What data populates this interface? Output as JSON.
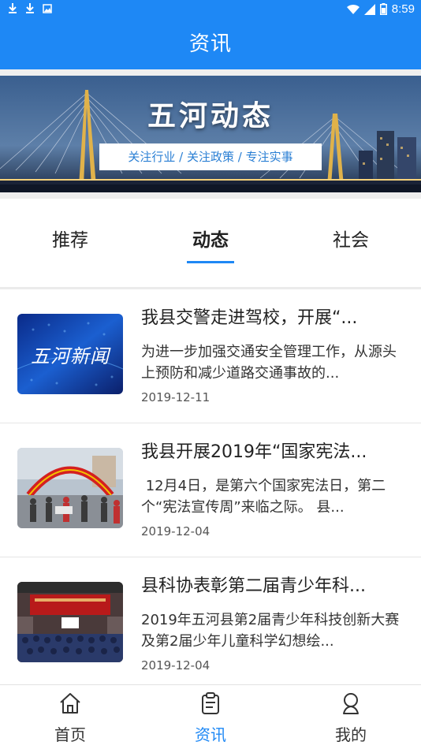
{
  "status_bar": {
    "time": "8:59",
    "left_icons": [
      "download-icon",
      "download-icon",
      "image-icon"
    ],
    "right_icons": [
      "wifi-icon",
      "signal-icon",
      "battery-icon"
    ]
  },
  "app_bar": {
    "title": "资讯"
  },
  "banner": {
    "title": "五河动态",
    "subtitle": "关注行业 / 关注政策 / 专注实事"
  },
  "tabs": [
    {
      "label": "推荐",
      "active": false
    },
    {
      "label": "动态",
      "active": true
    },
    {
      "label": "社会",
      "active": false
    }
  ],
  "news": [
    {
      "title": "我县交警走进驾校，开展“...",
      "summary": "为进一步加强交通安全管理工作，从源头上预防和减少道路交通事故的...",
      "date": "2019-12-11",
      "thumb_text": "五河新闻"
    },
    {
      "title": "我县开展2019年“国家宪法...",
      "summary": " 12月4日，是第六个国家宪法日，第二个“宪法宣传周”来临之际。 县...",
      "date": "2019-12-04"
    },
    {
      "title": "县科协表彰第二届青少年科...",
      "summary": "2019年五河县第2届青少年科技创新大赛及第2届少年儿童科学幻想绘...",
      "date": "2019-12-04"
    }
  ],
  "bottom_nav": [
    {
      "label": "首页",
      "icon": "home-icon",
      "active": false
    },
    {
      "label": "资讯",
      "icon": "news-clipboard-icon",
      "active": true
    },
    {
      "label": "我的",
      "icon": "profile-icon",
      "active": false
    }
  ],
  "colors": {
    "primary": "#1e88f5",
    "active_tab_indicator": "#1e88f5"
  }
}
